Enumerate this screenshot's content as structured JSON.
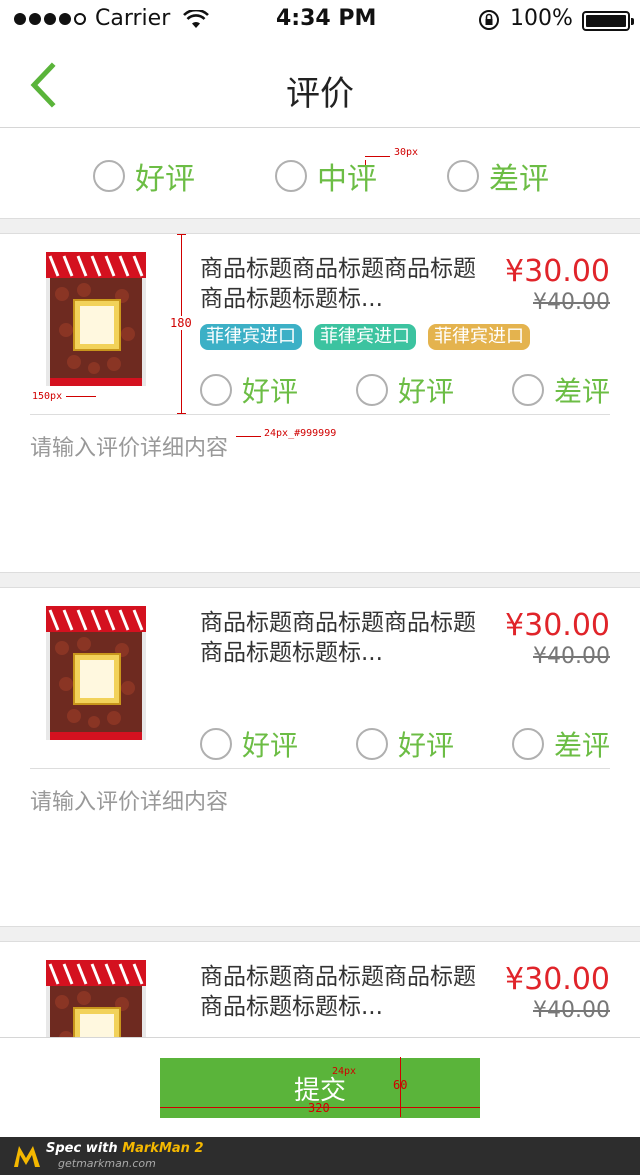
{
  "status_bar": {
    "carrier": "Carrier",
    "time": "4:34 PM",
    "battery": "100%"
  },
  "nav": {
    "title": "评价"
  },
  "overall_rating": {
    "options": [
      "好评",
      "中评",
      "差评"
    ]
  },
  "products": [
    {
      "title": "商品标题商品标题商品标题商品标题标题标...",
      "price": "¥30.00",
      "original_price": "¥40.00",
      "tags": [
        {
          "label": "菲律宾进口",
          "color": "#3cb0c6"
        },
        {
          "label": "菲律宾进口",
          "color": "#3cc3a0"
        },
        {
          "label": "菲律宾进口",
          "color": "#e4b34e"
        }
      ],
      "rating_options": [
        "好评",
        "好评",
        "差评"
      ],
      "comment_placeholder": "请输入评价详细内容"
    },
    {
      "title": "商品标题商品标题商品标题商品标题标题标...",
      "price": "¥30.00",
      "original_price": "¥40.00",
      "tags": [],
      "rating_options": [
        "好评",
        "好评",
        "差评"
      ],
      "comment_placeholder": "请输入评价详细内容"
    },
    {
      "title": "商品标题商品标题商品标题商品标题标题标...",
      "price": "¥30.00",
      "original_price": "¥40.00",
      "tags": [],
      "rating_options": [],
      "comment_placeholder": ""
    }
  ],
  "submit": {
    "label": "提交"
  },
  "annotations": {
    "a30": "30px",
    "a180": "180",
    "a150": "150px",
    "a24": "24px_#999999",
    "a24b": "24px",
    "a60": "60",
    "a320": "320"
  },
  "watermark": {
    "line1_prefix": "Spec with ",
    "line1_accent": "MarkMan 2",
    "line2": "getmarkman.com"
  },
  "colors": {
    "accent_green": "#6cbd45",
    "button_green": "#5ab43a",
    "price_red": "#e0242a"
  }
}
